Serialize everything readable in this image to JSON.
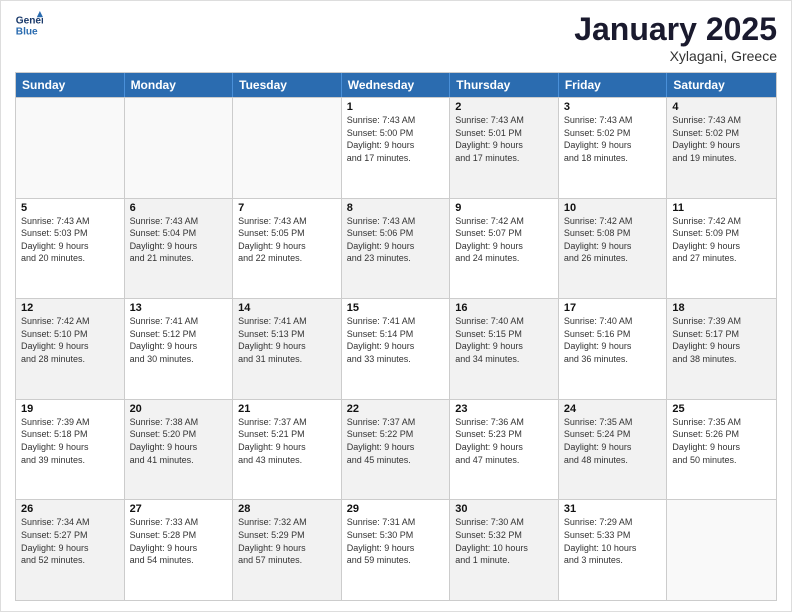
{
  "logo": {
    "line1": "General",
    "line2": "Blue"
  },
  "title": "January 2025",
  "subtitle": "Xylagani, Greece",
  "headers": [
    "Sunday",
    "Monday",
    "Tuesday",
    "Wednesday",
    "Thursday",
    "Friday",
    "Saturday"
  ],
  "weeks": [
    [
      {
        "day": "",
        "info": "",
        "empty": true
      },
      {
        "day": "",
        "info": "",
        "empty": true
      },
      {
        "day": "",
        "info": "",
        "empty": true
      },
      {
        "day": "1",
        "info": "Sunrise: 7:43 AM\nSunset: 5:00 PM\nDaylight: 9 hours\nand 17 minutes.",
        "shaded": false
      },
      {
        "day": "2",
        "info": "Sunrise: 7:43 AM\nSunset: 5:01 PM\nDaylight: 9 hours\nand 17 minutes.",
        "shaded": true
      },
      {
        "day": "3",
        "info": "Sunrise: 7:43 AM\nSunset: 5:02 PM\nDaylight: 9 hours\nand 18 minutes.",
        "shaded": false
      },
      {
        "day": "4",
        "info": "Sunrise: 7:43 AM\nSunset: 5:02 PM\nDaylight: 9 hours\nand 19 minutes.",
        "shaded": true
      }
    ],
    [
      {
        "day": "5",
        "info": "Sunrise: 7:43 AM\nSunset: 5:03 PM\nDaylight: 9 hours\nand 20 minutes.",
        "shaded": false
      },
      {
        "day": "6",
        "info": "Sunrise: 7:43 AM\nSunset: 5:04 PM\nDaylight: 9 hours\nand 21 minutes.",
        "shaded": true
      },
      {
        "day": "7",
        "info": "Sunrise: 7:43 AM\nSunset: 5:05 PM\nDaylight: 9 hours\nand 22 minutes.",
        "shaded": false
      },
      {
        "day": "8",
        "info": "Sunrise: 7:43 AM\nSunset: 5:06 PM\nDaylight: 9 hours\nand 23 minutes.",
        "shaded": true
      },
      {
        "day": "9",
        "info": "Sunrise: 7:42 AM\nSunset: 5:07 PM\nDaylight: 9 hours\nand 24 minutes.",
        "shaded": false
      },
      {
        "day": "10",
        "info": "Sunrise: 7:42 AM\nSunset: 5:08 PM\nDaylight: 9 hours\nand 26 minutes.",
        "shaded": true
      },
      {
        "day": "11",
        "info": "Sunrise: 7:42 AM\nSunset: 5:09 PM\nDaylight: 9 hours\nand 27 minutes.",
        "shaded": false
      }
    ],
    [
      {
        "day": "12",
        "info": "Sunrise: 7:42 AM\nSunset: 5:10 PM\nDaylight: 9 hours\nand 28 minutes.",
        "shaded": true
      },
      {
        "day": "13",
        "info": "Sunrise: 7:41 AM\nSunset: 5:12 PM\nDaylight: 9 hours\nand 30 minutes.",
        "shaded": false
      },
      {
        "day": "14",
        "info": "Sunrise: 7:41 AM\nSunset: 5:13 PM\nDaylight: 9 hours\nand 31 minutes.",
        "shaded": true
      },
      {
        "day": "15",
        "info": "Sunrise: 7:41 AM\nSunset: 5:14 PM\nDaylight: 9 hours\nand 33 minutes.",
        "shaded": false
      },
      {
        "day": "16",
        "info": "Sunrise: 7:40 AM\nSunset: 5:15 PM\nDaylight: 9 hours\nand 34 minutes.",
        "shaded": true
      },
      {
        "day": "17",
        "info": "Sunrise: 7:40 AM\nSunset: 5:16 PM\nDaylight: 9 hours\nand 36 minutes.",
        "shaded": false
      },
      {
        "day": "18",
        "info": "Sunrise: 7:39 AM\nSunset: 5:17 PM\nDaylight: 9 hours\nand 38 minutes.",
        "shaded": true
      }
    ],
    [
      {
        "day": "19",
        "info": "Sunrise: 7:39 AM\nSunset: 5:18 PM\nDaylight: 9 hours\nand 39 minutes.",
        "shaded": false
      },
      {
        "day": "20",
        "info": "Sunrise: 7:38 AM\nSunset: 5:20 PM\nDaylight: 9 hours\nand 41 minutes.",
        "shaded": true
      },
      {
        "day": "21",
        "info": "Sunrise: 7:37 AM\nSunset: 5:21 PM\nDaylight: 9 hours\nand 43 minutes.",
        "shaded": false
      },
      {
        "day": "22",
        "info": "Sunrise: 7:37 AM\nSunset: 5:22 PM\nDaylight: 9 hours\nand 45 minutes.",
        "shaded": true
      },
      {
        "day": "23",
        "info": "Sunrise: 7:36 AM\nSunset: 5:23 PM\nDaylight: 9 hours\nand 47 minutes.",
        "shaded": false
      },
      {
        "day": "24",
        "info": "Sunrise: 7:35 AM\nSunset: 5:24 PM\nDaylight: 9 hours\nand 48 minutes.",
        "shaded": true
      },
      {
        "day": "25",
        "info": "Sunrise: 7:35 AM\nSunset: 5:26 PM\nDaylight: 9 hours\nand 50 minutes.",
        "shaded": false
      }
    ],
    [
      {
        "day": "26",
        "info": "Sunrise: 7:34 AM\nSunset: 5:27 PM\nDaylight: 9 hours\nand 52 minutes.",
        "shaded": true
      },
      {
        "day": "27",
        "info": "Sunrise: 7:33 AM\nSunset: 5:28 PM\nDaylight: 9 hours\nand 54 minutes.",
        "shaded": false
      },
      {
        "day": "28",
        "info": "Sunrise: 7:32 AM\nSunset: 5:29 PM\nDaylight: 9 hours\nand 57 minutes.",
        "shaded": true
      },
      {
        "day": "29",
        "info": "Sunrise: 7:31 AM\nSunset: 5:30 PM\nDaylight: 9 hours\nand 59 minutes.",
        "shaded": false
      },
      {
        "day": "30",
        "info": "Sunrise: 7:30 AM\nSunset: 5:32 PM\nDaylight: 10 hours\nand 1 minute.",
        "shaded": true
      },
      {
        "day": "31",
        "info": "Sunrise: 7:29 AM\nSunset: 5:33 PM\nDaylight: 10 hours\nand 3 minutes.",
        "shaded": false
      },
      {
        "day": "",
        "info": "",
        "empty": true
      }
    ]
  ]
}
